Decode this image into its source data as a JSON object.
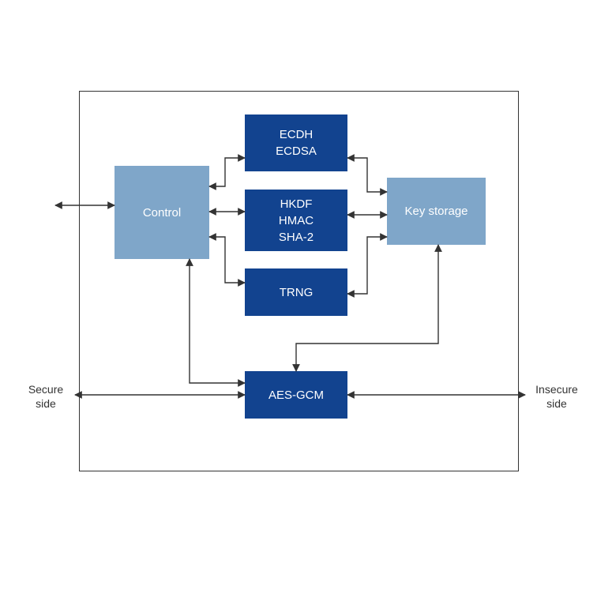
{
  "blocks": {
    "control": "Control",
    "ecdh": "ECDH\nECDSA",
    "hkdf": "HKDF\nHMAC\nSHA-2",
    "trng": "TRNG",
    "aesgcm": "AES-GCM",
    "keystore": "Key storage"
  },
  "labels": {
    "secure": "Secure\nside",
    "insecure": "Insecure\nside"
  },
  "colors": {
    "light": "#7fa6c9",
    "dark": "#12438f"
  }
}
